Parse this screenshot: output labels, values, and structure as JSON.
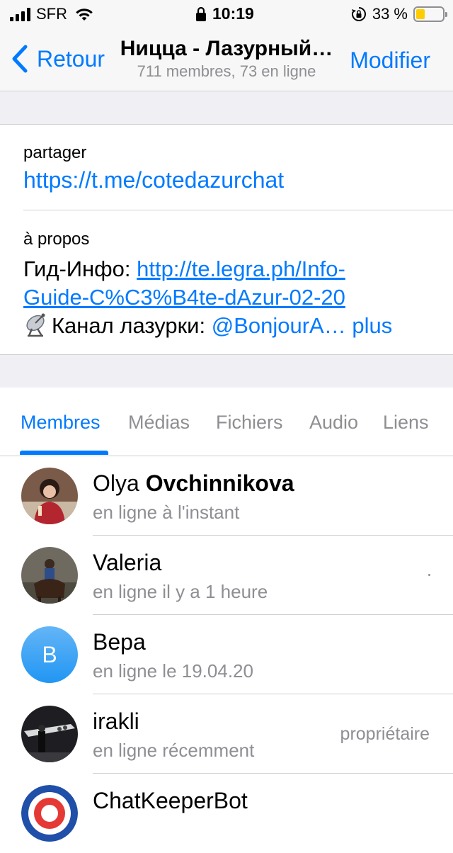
{
  "status_bar": {
    "carrier": "SFR",
    "time": "10:19",
    "battery_percent": "33 %",
    "battery_level": 0.33,
    "icons": [
      "signal-icon",
      "wifi-icon",
      "lock-icon",
      "rotation-lock-icon",
      "battery-icon"
    ]
  },
  "navbar": {
    "back_label": "Retour",
    "title": "Ницца - Лазурный…",
    "subtitle": "711 membres, 73 en ligne",
    "edit_label": "Modifier"
  },
  "info": {
    "share_label": "partager",
    "share_link": "https://t.me/cotedazurchat",
    "about_label": "à propos",
    "about_prefix": "Гид-Инфо: ",
    "about_link_part1": "http://te.legra.ph/Info-",
    "about_link_part2": "Guide-C%C3%B4te-dAzur-02-20",
    "about_line3_text": "Канал лазурки: ",
    "about_line3_mention": "@BonjourA…",
    "more_label": " plus"
  },
  "tabs": [
    {
      "label": "Membres",
      "active": true
    },
    {
      "label": "Médias",
      "active": false
    },
    {
      "label": "Fichiers",
      "active": false
    },
    {
      "label": "Audio",
      "active": false
    },
    {
      "label": "Liens",
      "active": false
    }
  ],
  "members": [
    {
      "first": "Olya",
      "last": "Ovchinnikova",
      "status": "en ligne à l'instant",
      "role": ""
    },
    {
      "first": "Valeria",
      "last": "",
      "status": "en ligne il y a 1 heure",
      "role": ""
    },
    {
      "first": "Вера",
      "last": "",
      "status": "en ligne le 19.04.20",
      "role": "",
      "initial": "В"
    },
    {
      "first": "irakli",
      "last": "",
      "status": "en ligne récemment",
      "role": "propriétaire"
    },
    {
      "first": "ChatKeeperBot",
      "last": "",
      "status": "",
      "role": ""
    }
  ],
  "colors": {
    "accent": "#007aff",
    "secondary_text": "#8e8e93",
    "background_gray": "#efeff4"
  }
}
